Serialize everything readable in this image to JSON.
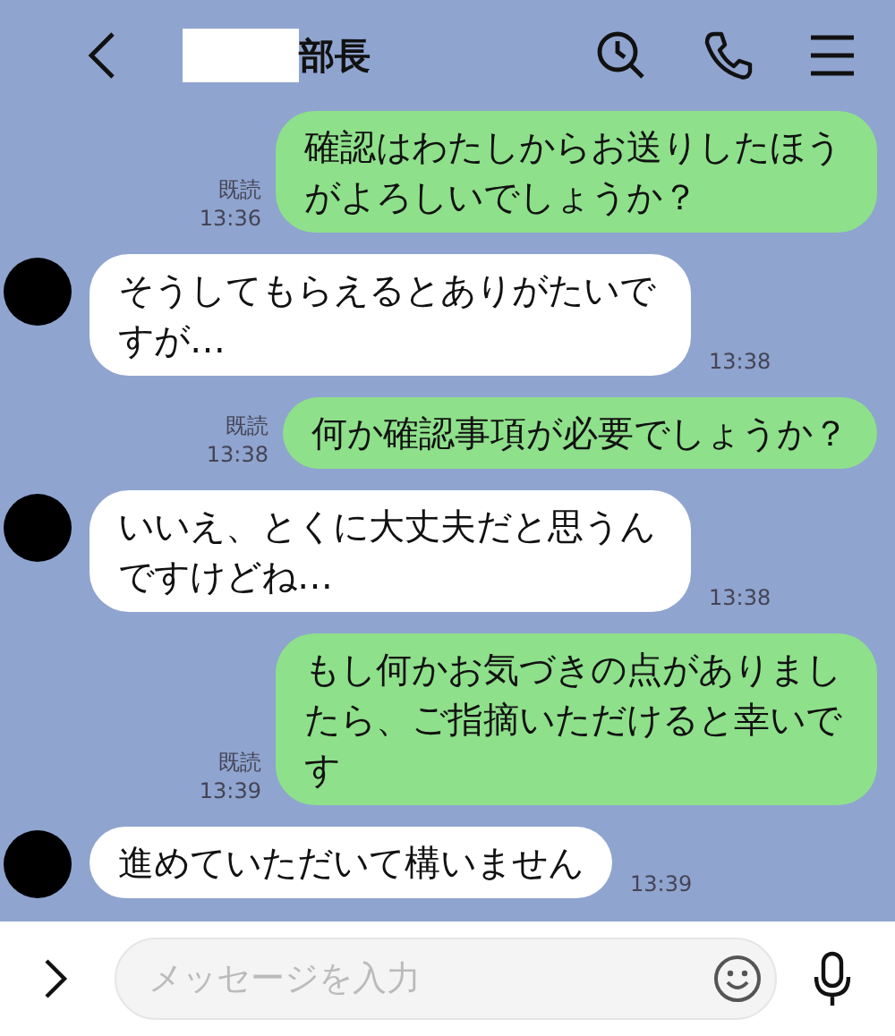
{
  "header": {
    "title": "部長"
  },
  "messages": [
    {
      "kind": "sent",
      "text": "確認はわたしからお送りしたほうがよろしいでしょうか？",
      "read": "既読",
      "time": "13:36"
    },
    {
      "kind": "received",
      "text": "そうしてもらえるとありがたいですが…",
      "time": "13:38"
    },
    {
      "kind": "sent",
      "text": "何か確認事項が必要でしょうか？",
      "read": "既読",
      "time": "13:38"
    },
    {
      "kind": "received",
      "text": "いいえ、とくに大丈夫だと思うんですけどね…",
      "time": "13:38"
    },
    {
      "kind": "sent",
      "text": "もし何かお気づきの点がありましたら、ご指摘いただけると幸いです",
      "read": "既読",
      "time": "13:39"
    },
    {
      "kind": "received",
      "text": "進めていただいて構いません",
      "time": "13:39"
    }
  ],
  "composer": {
    "placeholder": "メッセージを入力"
  }
}
